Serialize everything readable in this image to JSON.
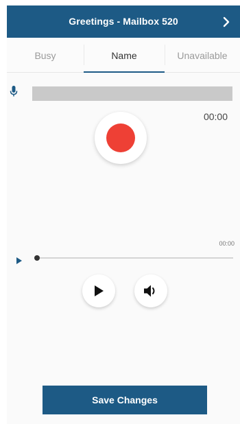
{
  "header": {
    "title": "Greetings - Mailbox 520",
    "next_icon": "chevron-right-icon"
  },
  "tabs": [
    {
      "label": "Busy",
      "active": false
    },
    {
      "label": "Name",
      "active": true
    },
    {
      "label": "Unavailable",
      "active": false
    }
  ],
  "recorder": {
    "mic_icon": "microphone-icon",
    "elapsed": "00:00",
    "record_icon": "record-icon"
  },
  "player": {
    "duration": "00:00",
    "progress": 0,
    "play_icon": "play-icon",
    "volume_icon": "volume-icon"
  },
  "footer": {
    "save_label": "Save Changes"
  },
  "colors": {
    "primary": "#1d5a85",
    "record": "#ee4035",
    "level_bar": "#c9c9c9"
  }
}
